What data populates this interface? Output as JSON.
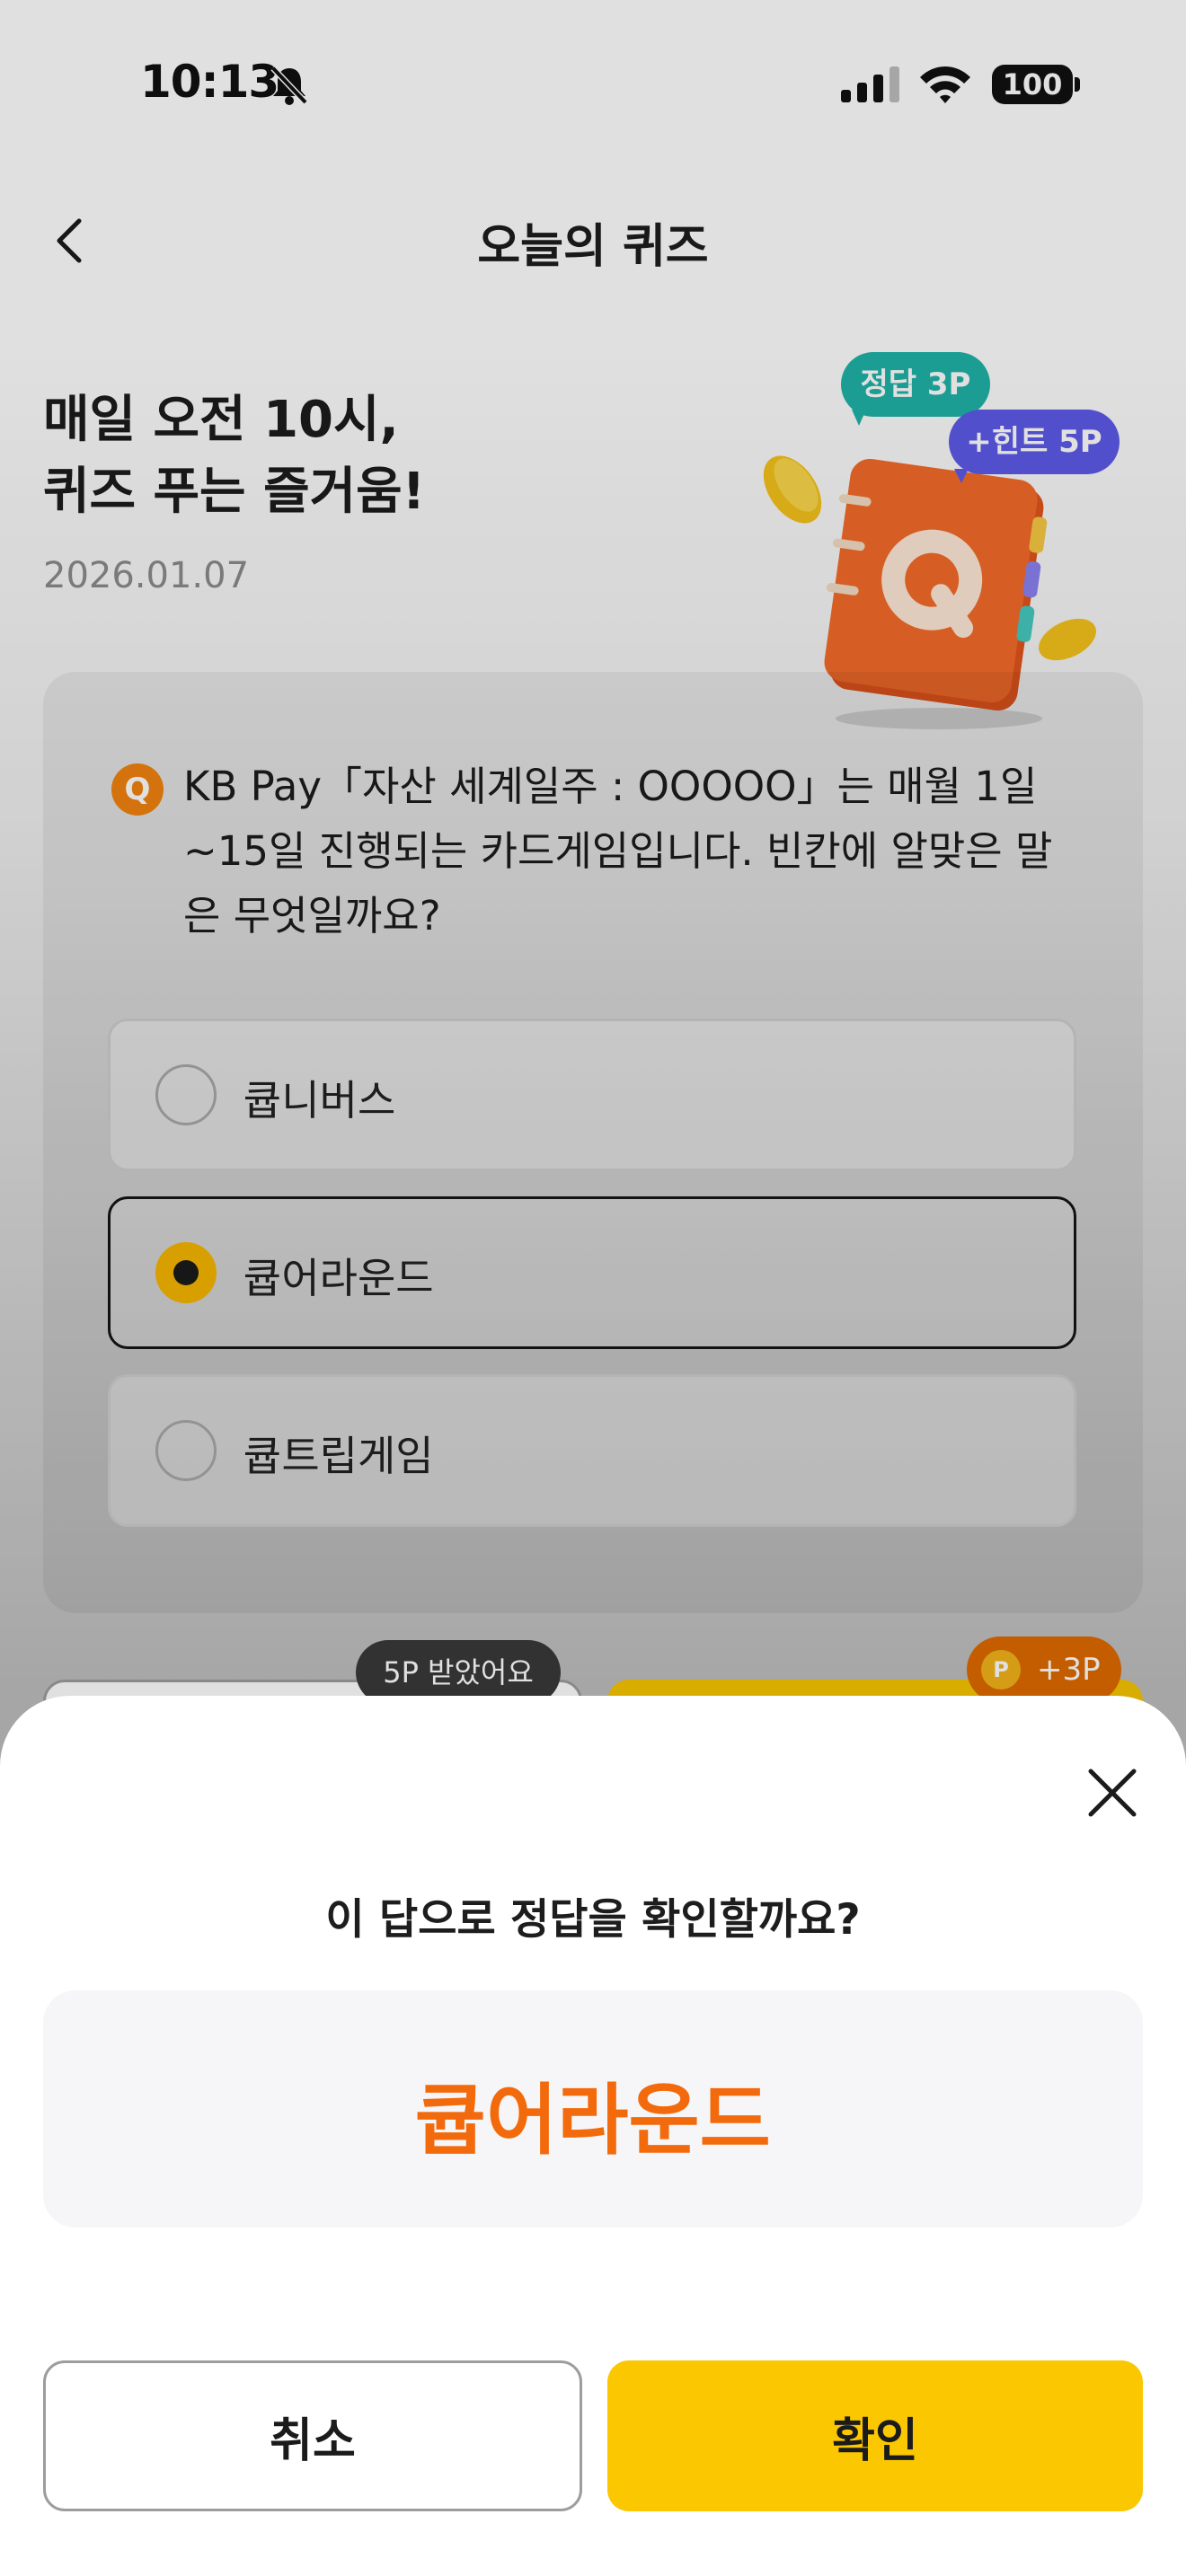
{
  "status_bar": {
    "time": "10:13",
    "battery": "100"
  },
  "header": {
    "title": "오늘의 퀴즈"
  },
  "hero": {
    "title_line1": "매일 오전 10시,",
    "title_line2": "퀴즈 푸는 즐거움!",
    "date": "2026.01.07",
    "badge_correct": "정답 3P",
    "badge_hint": "+힌트 5P"
  },
  "quiz": {
    "q_badge": "Q",
    "question": "KB Pay「자산 세계일주 : OOOOO」는 매월 1일 ~15일 진행되는 카드게임입니다. 빈칸에 알맞은 말은 무엇일까요?",
    "options": [
      {
        "label": "큡니버스",
        "selected": false
      },
      {
        "label": "큡어라운드",
        "selected": true
      },
      {
        "label": "큡트립게임",
        "selected": false
      }
    ]
  },
  "tags": {
    "hint_received": "5P 받았어요",
    "coin": "P",
    "bonus": "+3P"
  },
  "sheet": {
    "question": "이 답으로 정답을 확인할까요?",
    "answer": "큡어라운드",
    "cancel_label": "취소",
    "confirm_label": "확인"
  },
  "colors": {
    "accent_yellow": "#fbc700",
    "answer_orange": "#f26a0c",
    "badge_teal": "#1fb3a8",
    "badge_purple": "#5d5ae8"
  }
}
